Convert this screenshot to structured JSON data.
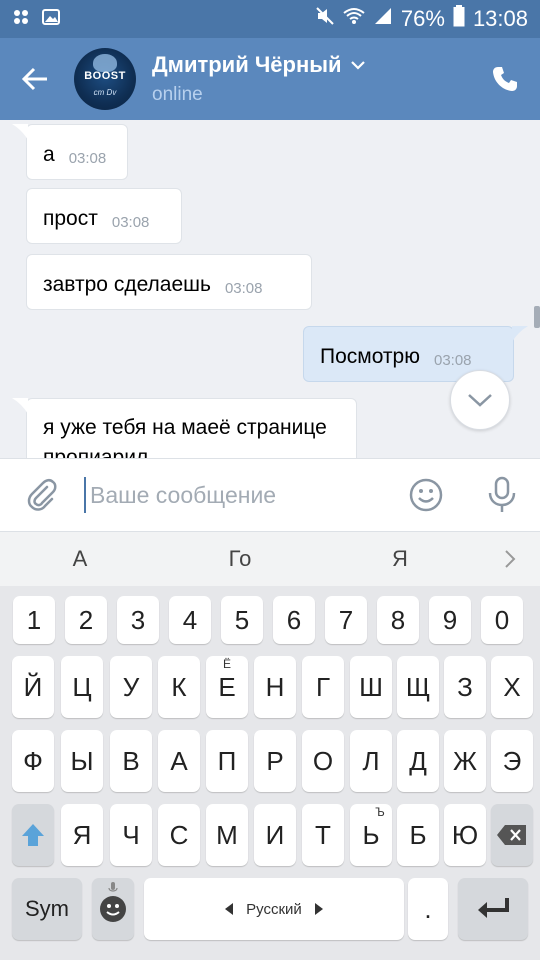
{
  "status_bar": {
    "battery": "76%",
    "time": "13:08"
  },
  "header": {
    "title": "Дмитрий Чёрный",
    "subtitle": "online",
    "avatar_text": "BOOST",
    "avatar_sub": "cm Dv"
  },
  "messages": [
    {
      "text": "а",
      "time": "03:08",
      "dir": "in"
    },
    {
      "text": "прост",
      "time": "03:08",
      "dir": "in"
    },
    {
      "text": "завтро сделаешь",
      "time": "03:08",
      "dir": "in"
    },
    {
      "text": "Посмотрю",
      "time": "03:08",
      "dir": "out"
    },
    {
      "text": "я уже тебя на маеё странице пропиарил",
      "time": "",
      "dir": "in"
    }
  ],
  "composer": {
    "placeholder": "Ваше сообщение"
  },
  "suggestions": [
    "А",
    "Го",
    "Я"
  ],
  "keyboard": {
    "row_digits": [
      "1",
      "2",
      "3",
      "4",
      "5",
      "6",
      "7",
      "8",
      "9",
      "0"
    ],
    "row1": [
      "Й",
      "Ц",
      "У",
      "К",
      "Е",
      "Н",
      "Г",
      "Ш",
      "Щ",
      "З",
      "Х"
    ],
    "row1_hint": "Ё",
    "row2": [
      "Ф",
      "Ы",
      "В",
      "А",
      "П",
      "Р",
      "О",
      "Л",
      "Д",
      "Ж",
      "Э"
    ],
    "row3": [
      "Я",
      "Ч",
      "С",
      "М",
      "И",
      "Т",
      "Ь",
      "Б",
      "Ю"
    ],
    "row3_hint": "Ъ",
    "sym": "Sym",
    "space": "Русский",
    "period": "."
  },
  "colors": {
    "header": "#5b88bd",
    "status_bar": "#4a76a8",
    "outgoing_bubble": "#dbe8f7",
    "shift_accent": "#5aa3d9"
  }
}
